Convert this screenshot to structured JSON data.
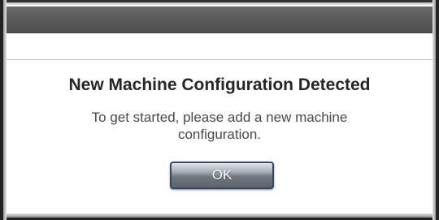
{
  "dialog": {
    "title_bar_color": "#5a5a5a",
    "heading": "New Machine Configuration Detected",
    "message_line1": "To get started, please add a new machine",
    "message_line2": "configuration.",
    "ok_label": "OK"
  }
}
